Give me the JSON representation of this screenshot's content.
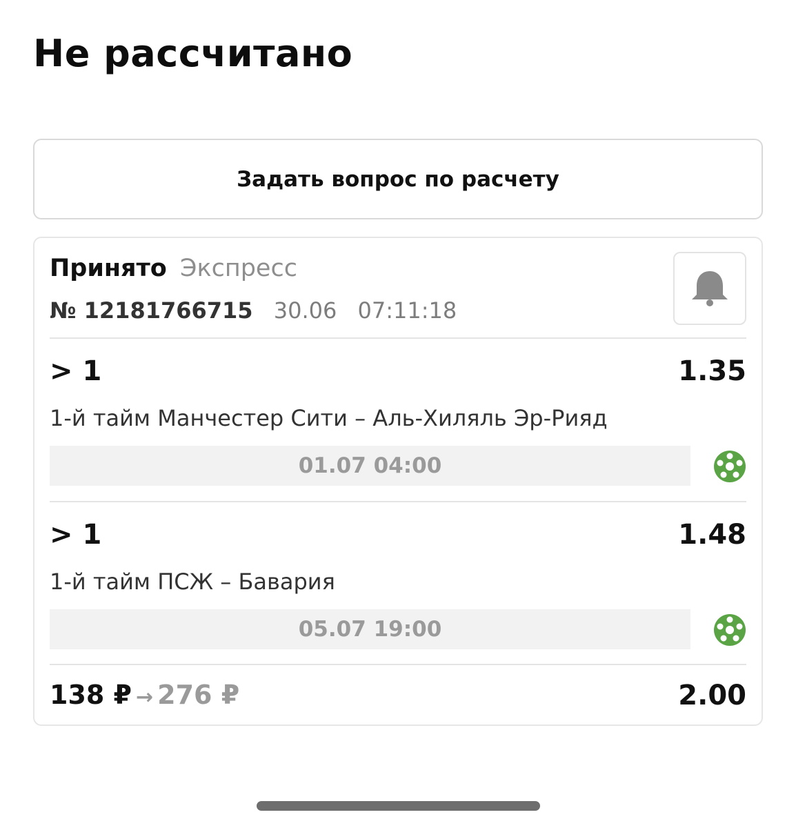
{
  "page": {
    "title": "Не рассчитано"
  },
  "ask_button": {
    "label": "Задать вопрос по расчету"
  },
  "bet": {
    "status": "Принято",
    "type": "Экспресс",
    "number": "№ 12181766715",
    "date": "30.06",
    "time": "07:11:18",
    "bell_icon": "bell-icon",
    "events": [
      {
        "outcome": "> 1",
        "odds": "1.35",
        "name": "1-й тайм Манчестер Сити – Аль-Хиляль Эр-Рияд",
        "start": "01.07 04:00",
        "sport_icon": "football-icon"
      },
      {
        "outcome": "> 1",
        "odds": "1.48",
        "name": "1-й тайм ПСЖ – Бавария",
        "start": "05.07 19:00",
        "sport_icon": "football-icon"
      }
    ],
    "stake": "138 ₽",
    "arrow": "→",
    "payout": "276 ₽",
    "total_odds": "2.00"
  },
  "colors": {
    "sport_icon_green": "#5aa445",
    "muted_text": "#8e8e8e",
    "date_bar_bg": "#f2f2f2"
  }
}
